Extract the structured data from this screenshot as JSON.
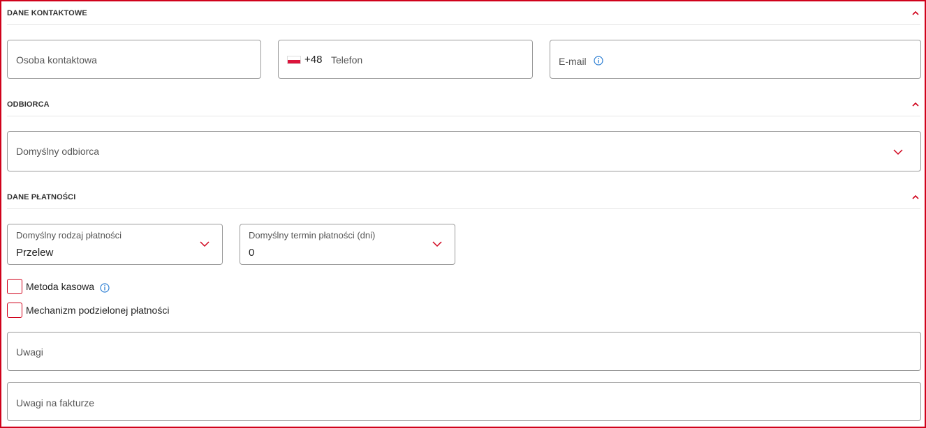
{
  "sections": {
    "contact": {
      "title": "DANE KONTAKTOWE"
    },
    "recipient": {
      "title": "ODBIORCA"
    },
    "payment": {
      "title": "DANE PŁATNOŚCI"
    }
  },
  "contact": {
    "person_placeholder": "Osoba kontaktowa",
    "phone_prefix": "+48",
    "phone_country": "PL",
    "phone_placeholder": "Telefon",
    "email_placeholder": "E-mail"
  },
  "recipient": {
    "default_placeholder": "Domyślny odbiorca"
  },
  "payment": {
    "type_label": "Domyślny rodzaj płatności",
    "type_value": "Przelew",
    "term_label": "Domyślny termin płatności (dni)",
    "term_value": "0",
    "cash_method_label": "Metoda kasowa",
    "cash_method_checked": false,
    "split_payment_label": "Mechanizm podzielonej płatności",
    "split_payment_checked": false
  },
  "notes": {
    "notes_placeholder": "Uwagi",
    "invoice_notes_placeholder": "Uwagi na fakturze"
  },
  "colors": {
    "accent": "#d0021b",
    "info": "#2d7fd3",
    "border": "#9a9a9a"
  }
}
